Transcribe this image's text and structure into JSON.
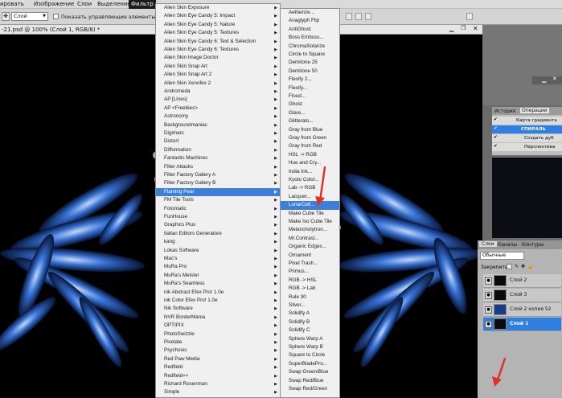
{
  "menubar": {
    "items": [
      "ировать",
      "Изображение",
      "Слои",
      "Выделение",
      "Фильтр"
    ],
    "active_index": 4
  },
  "options_bar": {
    "select_value": "Слой",
    "checkbox_label": "Показать управляющие элементы"
  },
  "document": {
    "tab_title": "-21.psd @ 100% (Слой 1, RGB/8) *"
  },
  "menu1": {
    "items": [
      "Alien Skin Exposure",
      "Alien Skin Eye Candy 5: Impact",
      "Alien Skin Eye Candy 5: Nature",
      "Alien Skin Eye Candy 5: Textures",
      "Alien Skin Eye Candy 6: Text & Selection",
      "Alien Skin Eye Candy 6: Textures",
      "Alien Skin Image Doctor",
      "Alien Skin Snap Art",
      "Alien Skin Snap Art 2",
      "Alien Skin Xenofex 2",
      "Andromeda",
      "AP [Lines]",
      "AP <Freebies>",
      "Astronomy",
      "Backgroundmaniac",
      "Digimarc",
      "Distort",
      "Difformation",
      "Fantastic Machines",
      "Filter Attacks",
      "Filter Factory Gallery A",
      "Filter Factory Gallery B",
      "Flaming Pear",
      "FM Tile Tools",
      "Fotomatic",
      "FunHouse",
      "Graphics Plus",
      "Italian Editors Generatore",
      "kang",
      "Lokas Software",
      "Mac's",
      "MuRa Pro",
      "MuRa's Meister",
      "MuRa's Seamless",
      "nik Abstract Efex Pro! 1.0e",
      "nik Color Efex Pro! 1.0e",
      "Nik Software",
      "NVR BorderMania",
      "OPTIPIX",
      "PhotoSwizzle",
      "Pixelate",
      "Psychosis",
      "Red Paw Media",
      "Redfield",
      "Redfield++",
      "Richard Rosenman",
      "Simple"
    ],
    "highlight_index": 22
  },
  "menu2": {
    "items": [
      "Aetherize...",
      "Anaglyph Flip",
      "AntiGhost",
      "Boss Emboss...",
      "ChromaSolarize",
      "Circle to Square",
      "Demitone 25",
      "Demitone 50",
      "Flexify 2...",
      "Flexify...",
      "Flood...",
      "Ghost",
      "Glare...",
      "Glitterato...",
      "Gray from Blue",
      "Gray from Green",
      "Gray from Red",
      "HSL -> RGB",
      "Hue and Cry...",
      "India Ink...",
      "Kyoto Color...",
      "Lab -> RGB",
      "Lacquer...",
      "LunarCell...",
      "Make Cube Tile",
      "Make Iso Cube Tile",
      "Melancholytron...",
      "Mr.Contrast...",
      "Organic Edges...",
      "Ornament",
      "Pixel Trash...",
      "Primus...",
      "RGB -> HSL",
      "RGB -> Lab",
      "Rule 30",
      "Silver...",
      "Solidify A",
      "Solidify B",
      "Solidify C",
      "Sphere Warp A",
      "Sphere Warp B",
      "Square to Circle",
      "SuperBladePro...",
      "Swap Green/Blue",
      "Swap Red/Blue",
      "Swap Red/Green"
    ],
    "highlight_index": 23
  },
  "history_panel": {
    "tabs": [
      "История",
      "Операции"
    ],
    "rows": [
      "Карта градиента",
      "СПИРАЛЬ",
      "Создать дуб",
      "Перспектива"
    ],
    "selected_index": 1
  },
  "layers_panel": {
    "tabs": [
      "Слои",
      "Каналы",
      "Контуры"
    ],
    "blend_mode": "Обычные",
    "lock_label": "Закрепить:",
    "layers": [
      "Слой 2",
      "Слой 3",
      "Слой 2 копия 52",
      "Слой 1"
    ],
    "selected_index": 3
  },
  "colors": {
    "highlight": "#3d7fd6",
    "accent_arrow": "#e0302a"
  }
}
